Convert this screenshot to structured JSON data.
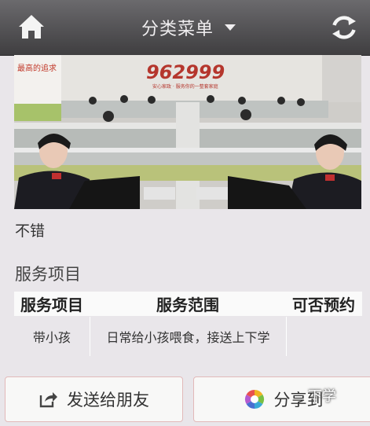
{
  "header": {
    "title": "分类菜单",
    "home_icon": "home-icon",
    "refresh_icon": "refresh-icon",
    "dropdown_icon": "caret-down-icon"
  },
  "photo": {
    "wall_slogan": "最高的追求",
    "logo_number": "962999",
    "logo_sub": "安心家政 · 服务你的一整套家庭"
  },
  "content": {
    "description": "不错",
    "section_title": "服务项目"
  },
  "table": {
    "headers": [
      "服务项目",
      "服务范围",
      "可否预约"
    ],
    "rows": [
      [
        "带小孩",
        "日常给小孩喂食，接送上下学",
        ""
      ]
    ]
  },
  "buttons": {
    "send_label": "发送给朋友",
    "share_label": "分享到",
    "overlay_text": "下学"
  },
  "colors": {
    "header_top": "#6b6a6d",
    "header_bottom": "#3f3e40",
    "background": "#e9e6ea",
    "button_border": "#e2b9b9"
  }
}
